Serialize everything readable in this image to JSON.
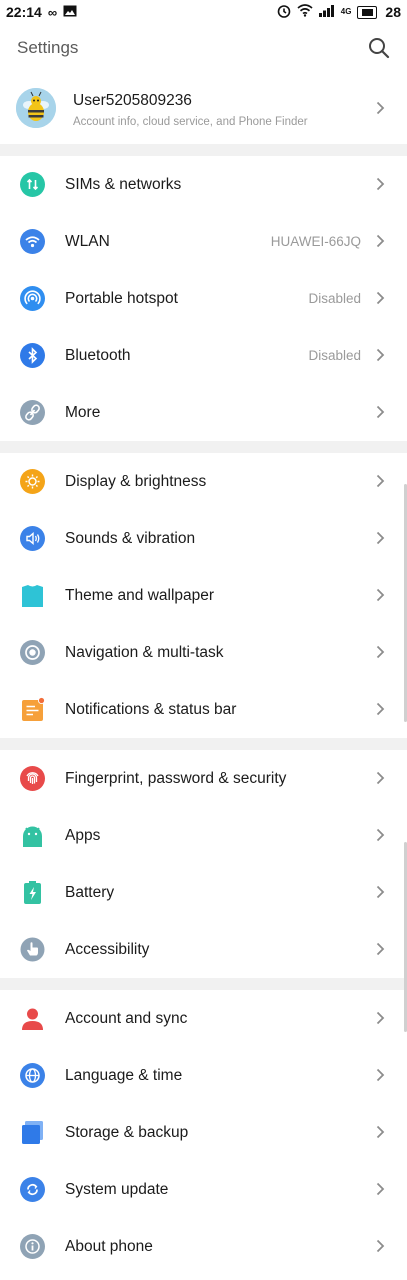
{
  "status_bar": {
    "time": "22:14",
    "battery": "28",
    "network": "4G"
  },
  "header": {
    "title": "Settings"
  },
  "profile": {
    "name": "User5205809236",
    "subtitle": "Account info, cloud service, and Phone Finder"
  },
  "groups": [
    [
      {
        "label": "SIMs & networks",
        "value": "",
        "icon": "sim-icon",
        "color": "#26c6a6"
      },
      {
        "label": "WLAN",
        "value": "HUAWEI-66JQ",
        "icon": "wifi-icon",
        "color": "#3b82e8"
      },
      {
        "label": "Portable hotspot",
        "value": "Disabled",
        "icon": "hotspot-icon",
        "color": "#2f8ef0"
      },
      {
        "label": "Bluetooth",
        "value": "Disabled",
        "icon": "bluetooth-icon",
        "color": "#2f7ae8"
      },
      {
        "label": "More",
        "value": "",
        "icon": "link-icon",
        "color": "#8fa3b5"
      }
    ],
    [
      {
        "label": "Display & brightness",
        "value": "",
        "icon": "sun-icon",
        "color": "#f4a418"
      },
      {
        "label": "Sounds & vibration",
        "value": "",
        "icon": "speaker-icon",
        "color": "#3b82e8"
      },
      {
        "label": "Theme and wallpaper",
        "value": "",
        "icon": "shirt-icon",
        "color": "#2ec3d6"
      },
      {
        "label": "Navigation & multi-task",
        "value": "",
        "icon": "navigation-icon",
        "color": "#8fa3b5"
      },
      {
        "label": "Notifications & status bar",
        "value": "",
        "icon": "notification-icon",
        "color": "#f6a03a"
      }
    ],
    [
      {
        "label": "Fingerprint, password & security",
        "value": "",
        "icon": "fingerprint-icon",
        "color": "#e84a4a"
      },
      {
        "label": "Apps",
        "value": "",
        "icon": "android-icon",
        "color": "#33c2a2"
      },
      {
        "label": "Battery",
        "value": "",
        "icon": "battery-icon",
        "color": "#33c2a2"
      },
      {
        "label": "Accessibility",
        "value": "",
        "icon": "hand-icon",
        "color": "#8fa3b5"
      }
    ],
    [
      {
        "label": "Account and sync",
        "value": "",
        "icon": "person-icon",
        "color": "#e84a4a"
      },
      {
        "label": "Language & time",
        "value": "",
        "icon": "globe-icon",
        "color": "#3b82e8"
      },
      {
        "label": "Storage & backup",
        "value": "",
        "icon": "storage-icon",
        "color": "#2f7ae8"
      },
      {
        "label": "System update",
        "value": "",
        "icon": "update-icon",
        "color": "#3b82e8"
      },
      {
        "label": "About phone",
        "value": "",
        "icon": "info-icon",
        "color": "#8fa3b5"
      }
    ]
  ]
}
